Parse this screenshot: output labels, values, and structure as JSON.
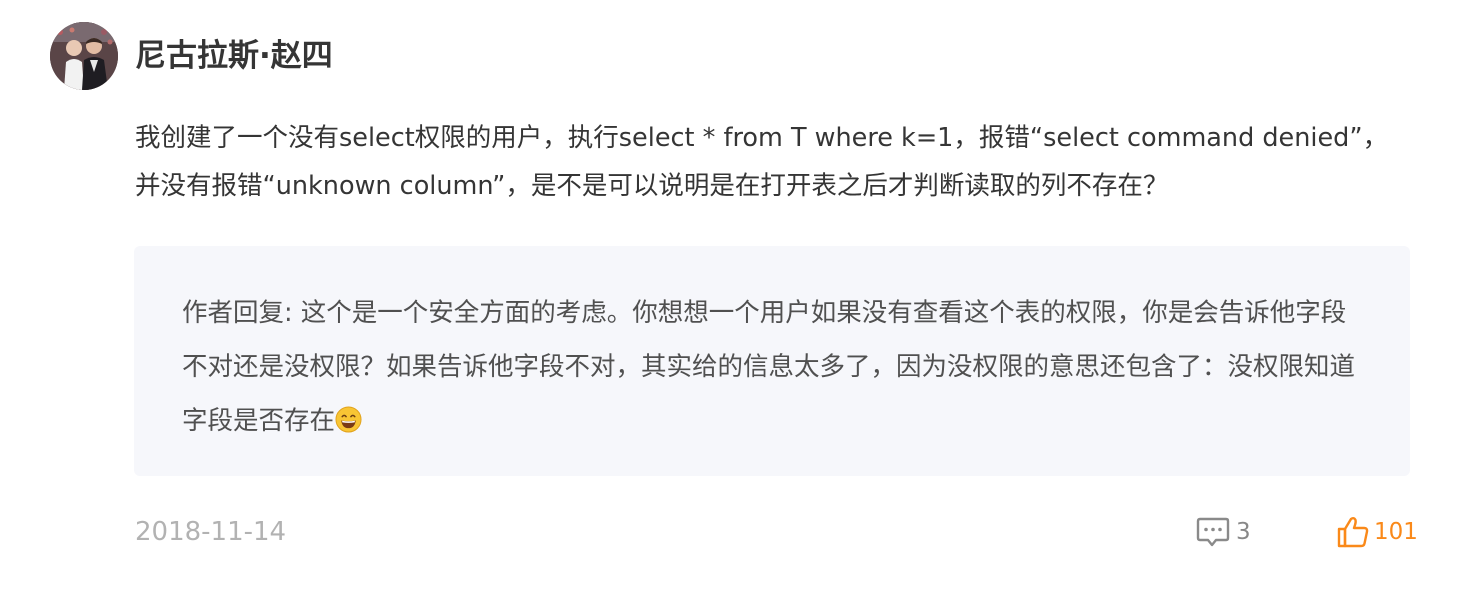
{
  "comment": {
    "username": "尼古拉斯·赵四",
    "content": "我创建了一个没有select权限的用户，执行select * from T where k=1，报错“select command denied”，并没有报错“unknown column”，是不是可以说明是在打开表之后才判断读取的列不存在？",
    "reply": {
      "text": "作者回复: 这个是一个安全方面的考虑。你想想一个用户如果没有查看这个表的权限，你是会告诉他字段不对还是没权限？如果告诉他字段不对，其实给的信息太多了，因为没权限的意思还包含了：没权限知道字段是否存在",
      "emoji": "grinning-face-icon"
    },
    "date": "2018-11-14",
    "reply_count": "3",
    "like_count": "101",
    "icons": {
      "reply": "comment-bubble-icon",
      "like": "thumbs-up-icon"
    },
    "colors": {
      "accent": "#fa8919",
      "reply_bg": "#f6f7fb",
      "muted": "#b2b2b2"
    }
  }
}
